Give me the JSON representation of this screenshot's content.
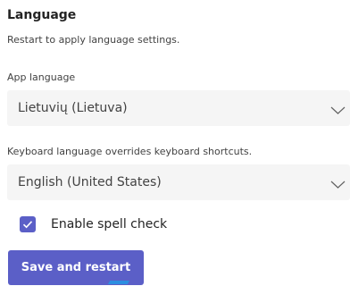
{
  "section": {
    "title": "Language",
    "subtitle": "Restart to apply language settings."
  },
  "app_language": {
    "label": "App language",
    "selected": "Lietuvių (Lietuva)"
  },
  "keyboard_language": {
    "label": "Keyboard language overrides keyboard shortcuts.",
    "selected": "English (United States)"
  },
  "spell_check": {
    "label": "Enable spell check",
    "checked": true
  },
  "save_button": {
    "label": "Save and restart"
  },
  "colors": {
    "accent": "#5b5fc7",
    "field_background": "#f5f5f5"
  },
  "icons": {
    "dropdown": "chevron-down-icon",
    "checkmark": "checkmark-icon"
  }
}
